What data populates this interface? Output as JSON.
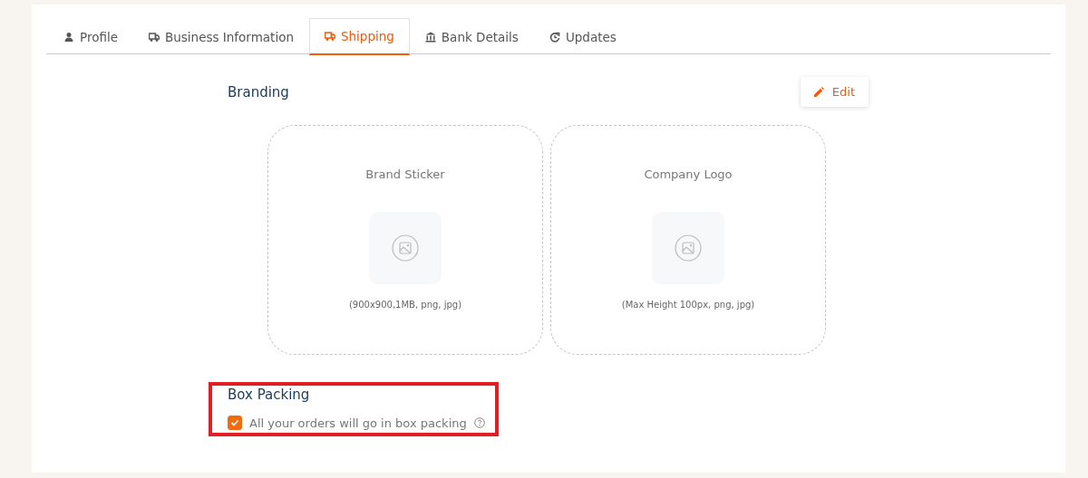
{
  "tabs": [
    {
      "label": "Profile",
      "kind": "person",
      "selected": false
    },
    {
      "label": "Business Information",
      "kind": "truck",
      "selected": false
    },
    {
      "label": "Shipping",
      "kind": "truck",
      "selected": true
    },
    {
      "label": "Bank Details",
      "kind": "bank",
      "selected": false
    },
    {
      "label": "Updates",
      "kind": "refresh",
      "selected": false
    }
  ],
  "branding": {
    "title": "Branding",
    "edit_button": "Edit",
    "uploads": [
      {
        "label": "Brand Sticker",
        "hint": "(900x900,1MB, png, jpg)"
      },
      {
        "label": "Company Logo",
        "hint": "(Max Height 100px, png, jpg)"
      }
    ]
  },
  "box_packing": {
    "title": "Box Packing",
    "option": {
      "label": "All your orders will go in box packing",
      "checked": true
    }
  }
}
